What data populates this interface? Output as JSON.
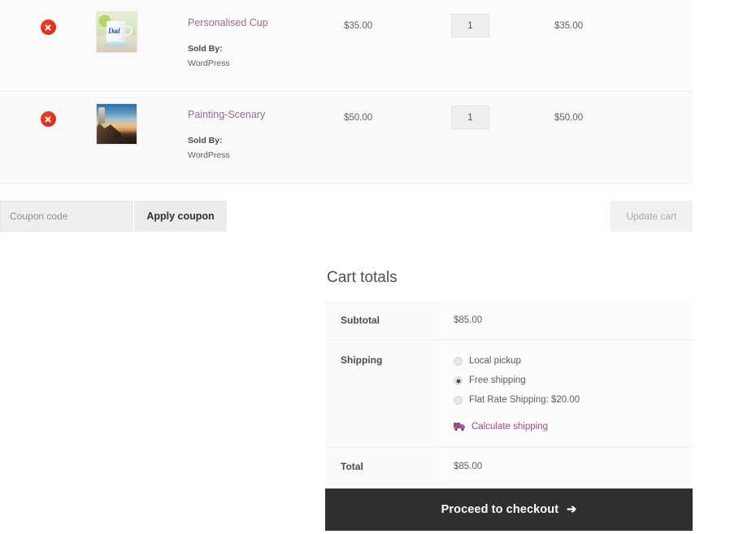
{
  "cart": {
    "items": [
      {
        "remove_label": "Remove this item",
        "thumbnail": "personalised-cup-thumbnail",
        "name": "Personalised Cup",
        "sold_by_label": "Sold By:",
        "vendor": "WordPress",
        "price": "$35.00",
        "quantity": "1",
        "subtotal": "$35.00"
      },
      {
        "remove_label": "Remove this item",
        "thumbnail": "painting-scenary-thumbnail",
        "name": "Painting-Scenary",
        "sold_by_label": "Sold By:",
        "vendor": "WordPress",
        "price": "$50.00",
        "quantity": "1",
        "subtotal": "$50.00"
      }
    ]
  },
  "actions": {
    "coupon_placeholder": "Coupon code",
    "coupon_value": "",
    "apply_coupon_label": "Apply coupon",
    "update_cart_label": "Update cart"
  },
  "totals": {
    "title": "Cart totals",
    "subtotal_label": "Subtotal",
    "subtotal_value": "$85.00",
    "shipping_label": "Shipping",
    "shipping_options": [
      {
        "label": "Local pickup",
        "selected": false
      },
      {
        "label": "Free shipping",
        "selected": true
      },
      {
        "label": "Flat Rate Shipping: $20.00",
        "selected": false
      }
    ],
    "calculate_shipping_label": "Calculate shipping",
    "total_label": "Total",
    "total_value": "$85.00"
  },
  "checkout": {
    "label": "Proceed to checkout",
    "arrow": "➔"
  },
  "colors": {
    "link": "#9b6b8f",
    "accent": "#9b4a86",
    "remove": "#e03118",
    "checkout_bg": "#2f2f2f"
  }
}
